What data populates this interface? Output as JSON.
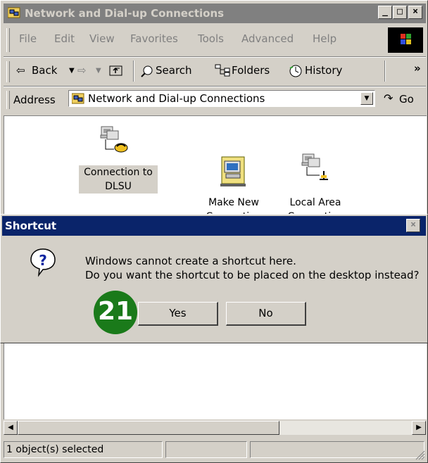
{
  "window": {
    "title": "Network and Dial-up Connections"
  },
  "menu": [
    "File",
    "Edit",
    "View",
    "Favorites",
    "Tools",
    "Advanced",
    "Help"
  ],
  "toolbar": {
    "back": "Back",
    "search": "Search",
    "folders": "Folders",
    "history": "History",
    "more": "»"
  },
  "address": {
    "label": "Address",
    "value": "Network and Dial-up Connections",
    "go": "Go"
  },
  "icons": [
    {
      "line1": "Connection to",
      "line2": "DLSU"
    },
    {
      "line1": "Make New",
      "line2": "Connection"
    },
    {
      "line1": "Local Area",
      "line2": "Connection"
    }
  ],
  "dialog": {
    "title": "Shortcut",
    "message_line1": "Windows cannot create a shortcut here.",
    "message_line2": "Do you want the shortcut to be placed on the desktop instead?",
    "yes": "Yes",
    "no": "No"
  },
  "step_badge": "21",
  "status": {
    "text": "1 object(s) selected"
  },
  "colors": {
    "dialog_title_bg": "#0a246a",
    "inactive_title_bg": "#808080",
    "badge": "#1a7a1a"
  }
}
